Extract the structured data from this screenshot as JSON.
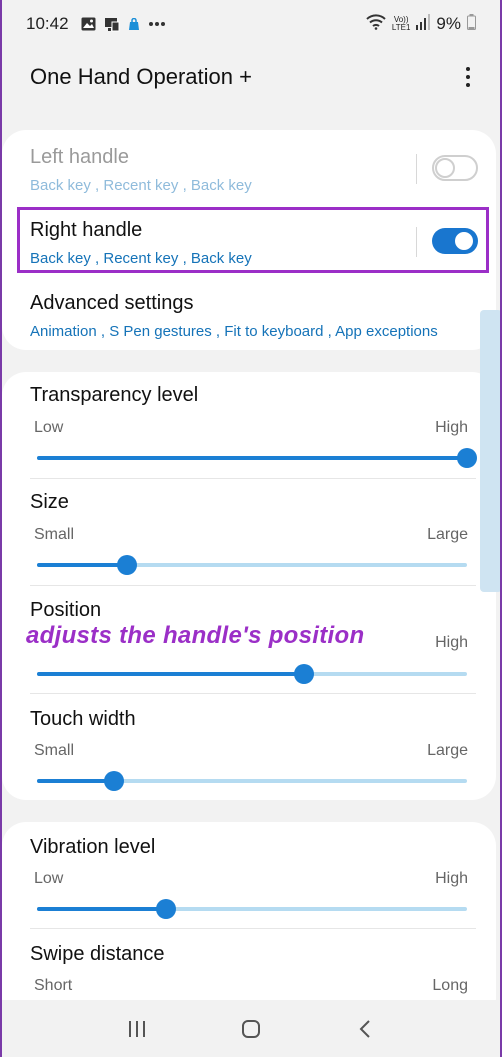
{
  "status_bar": {
    "time": "10:42",
    "icons": [
      "image-icon",
      "cast-icon",
      "bag-icon",
      "more-dots-icon"
    ],
    "lte_top": "Vo))",
    "lte_bottom": "LTE1",
    "battery": "9%"
  },
  "header": {
    "title": "One Hand Operation +",
    "more_icon": "vertical-dots-icon"
  },
  "handles": {
    "left": {
      "label": "Left handle",
      "sub": "Back key , Recent key , Back key",
      "enabled": false
    },
    "right": {
      "label": "Right handle",
      "sub": "Back key , Recent key , Back key",
      "enabled": true
    },
    "advanced": {
      "label": "Advanced settings",
      "sub": "Animation , S Pen gestures , Fit to keyboard , App exceptions"
    }
  },
  "sliders": [
    {
      "label": "Transparency level",
      "low": "Low",
      "high": "High",
      "value": 1.0
    },
    {
      "label": "Size",
      "low": "Small",
      "high": "Large",
      "value": 0.21
    },
    {
      "label": "Position",
      "low": "",
      "high": "High",
      "value": 0.62
    },
    {
      "label": "Touch width",
      "low": "Small",
      "high": "Large",
      "value": 0.18
    }
  ],
  "sliders2": [
    {
      "label": "Vibration level",
      "low": "Low",
      "high": "High",
      "value": 0.3
    },
    {
      "label": "Swipe distance",
      "low": "Short",
      "high": "Long",
      "value": null
    }
  ],
  "annotation": "adjusts the handle's position",
  "colors": {
    "accent": "#1b7fd4",
    "highlight": "#9b2fc7",
    "sub_text": "#1573b8"
  },
  "navbar": {
    "icons": [
      "recents-icon",
      "home-icon",
      "back-icon"
    ]
  }
}
